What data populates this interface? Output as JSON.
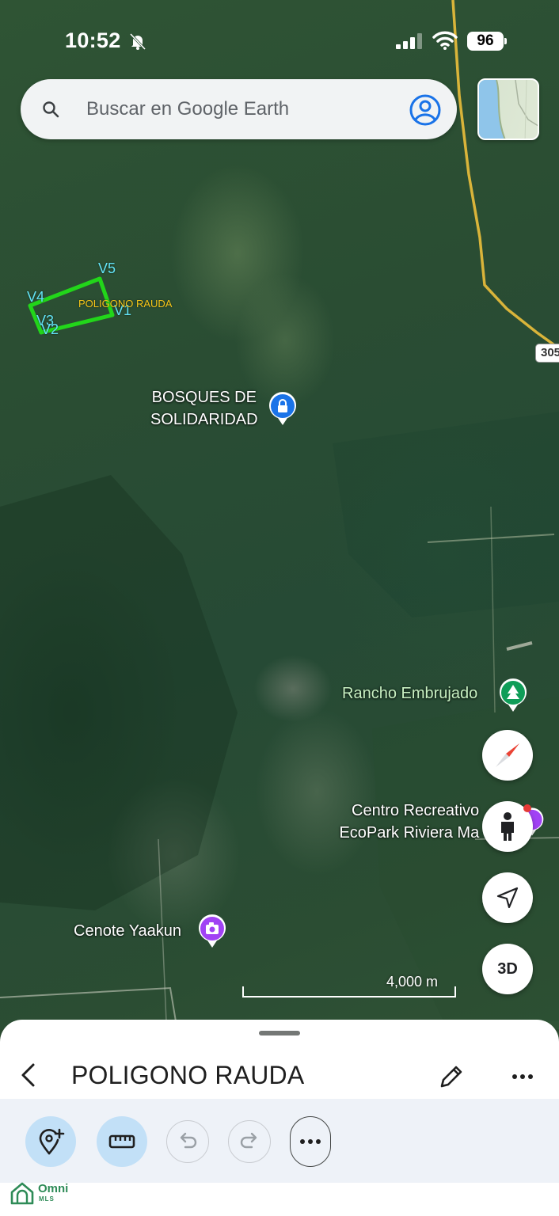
{
  "status_bar": {
    "time": "10:52",
    "battery": "96",
    "icons": [
      "bell-slash-icon",
      "signal-icon",
      "wifi-icon",
      "battery-icon"
    ]
  },
  "search": {
    "placeholder": "Buscar en Google Earth",
    "icons": [
      "search-icon",
      "account-icon"
    ]
  },
  "map": {
    "polygon": {
      "name": "POLIGONO RAUDA",
      "vertices": [
        "V5",
        "V4",
        "V3",
        "V2",
        "V1"
      ],
      "stroke_color": "#22d61a"
    },
    "road_shield": "305",
    "places": [
      {
        "name_line1": "BOSQUES DE",
        "name_line2": "SOLIDARIDAD",
        "icon": "lock-pin-icon",
        "color": "#1a73e8"
      },
      {
        "name": "Rancho Embrujado",
        "icon": "tree-pin-icon",
        "color": "#0f9d58"
      },
      {
        "name_line1": "Centro Recreativo",
        "name_line2": "EcoPark Riviera Ma",
        "icon": "camera-pin-icon",
        "color": "#a142f4"
      },
      {
        "name": "Cenote Yaakun",
        "icon": "camera-pin-icon",
        "color": "#a142f4"
      }
    ],
    "scale": "4,000 m",
    "controls": {
      "compass": "compass-icon",
      "street_view": "pegman-icon",
      "my_location": "navigation-arrow-icon",
      "three_d": "3D"
    }
  },
  "sheet": {
    "title": "POLIGONO RAUDA",
    "toolbar_icons": [
      "add-place-icon",
      "ruler-icon",
      "undo-icon",
      "redo-icon",
      "more-horizontal-icon"
    ]
  },
  "watermark": {
    "brand": "Omni",
    "sub": "MLS"
  }
}
